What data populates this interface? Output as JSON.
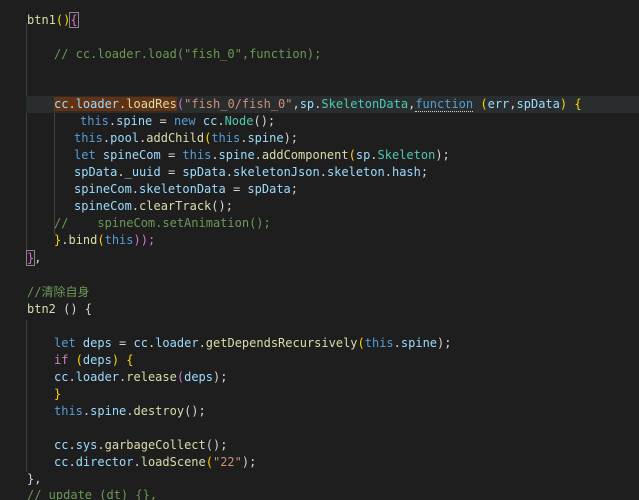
{
  "editor": {
    "lines": {
      "l1": {
        "name": "btn1",
        "paren": "()",
        "brace": "{"
      },
      "l3": {
        "comment": "// cc.loader.load(\"fish_0\",function);"
      },
      "l6": {
        "obj": "cc",
        "dot1": ".",
        "prop": "loader",
        "dot2": ".",
        "fn": "loadRes",
        "open": "(",
        "str": "\"fish_0/fish_0\"",
        "comma1": ",",
        "ns": "sp",
        "dot3": ".",
        "cls": "SkeletonData",
        "comma2": ",",
        "kw": "function",
        "space": " ",
        "argsOpen": "(",
        "arg1": "err",
        "comma3": ",",
        "arg2": "spData",
        "argsClose": ")",
        "brace": " {"
      },
      "l7": {
        "this": "this",
        "a": ".",
        "b": "spine",
        "c": " = ",
        "new": "new",
        "d": " ",
        "e": "cc",
        "f": ".",
        "g": "Node",
        "h": "();"
      },
      "l8": {
        "this": "this",
        "a": ".",
        "b": "pool",
        "c": ".",
        "fn": "addChild",
        "d": "(",
        "this2": "this",
        "e": ".",
        "f": "spine",
        "g": ");"
      },
      "l9": {
        "let": "let",
        "a": " ",
        "b": "spineCom",
        "c": " = ",
        "this": "this",
        "d": ".",
        "e": "spine",
        "f": ".",
        "fn": "addComponent",
        "g": "(",
        "h": "sp",
        "i": ".",
        "cls": "Skeleton",
        "j": ");"
      },
      "l10": {
        "a": "spData",
        "b": ".",
        "c": "_uuid",
        "d": " = ",
        "e": "spData",
        "f": ".",
        "g": "skeletonJson",
        "h": ".",
        "i": "skeleton",
        "j": ".",
        "k": "hash",
        "l": ";"
      },
      "l11": {
        "a": "spineCom",
        "b": ".",
        "c": "skeletonData",
        "d": " = ",
        "e": "spData",
        "f": ";"
      },
      "l12": {
        "a": "spineCom",
        "b": ".",
        "fn": "clearTrack",
        "c": "();"
      },
      "l13": {
        "comment": "//    spineCom.setAnimation();"
      },
      "l14": {
        "a": "}",
        "b": ".",
        "fn": "bind",
        "c": "(",
        "this": "this",
        "d": "));"
      },
      "l15": {
        "a": "}",
        "b": ","
      },
      "l17": {
        "comment": "//清除自身"
      },
      "l18": {
        "name": "btn2",
        "a": " () {"
      },
      "l20": {
        "let": "let",
        "a": " ",
        "b": "deps",
        "c": " = ",
        "d": "cc",
        "e": ".",
        "f": "loader",
        "g": ".",
        "fn": "getDependsRecursively",
        "h": "(",
        "this": "this",
        "i": ".",
        "j": "spine",
        "k": ");"
      },
      "l21": {
        "if": "if",
        "a": " (",
        "b": "deps",
        "c": ") {"
      },
      "l22": {
        "a": "cc",
        "b": ".",
        "c": "loader",
        "d": ".",
        "fn": "release",
        "e": "(",
        "f": "deps",
        "g": ");"
      },
      "l23": {
        "a": "}"
      },
      "l24": {
        "this": "this",
        "a": ".",
        "b": "spine",
        "c": ".",
        "fn": "destroy",
        "d": "();"
      },
      "l26": {
        "a": "cc",
        "b": ".",
        "c": "sys",
        "d": ".",
        "fn": "garbageCollect",
        "e": "();"
      },
      "l27": {
        "a": "cc",
        "b": ".",
        "c": "director",
        "d": ".",
        "fn": "loadScene",
        "e": "(",
        "str": "\"22\"",
        "f": ");"
      },
      "l28": {
        "a": "},"
      },
      "l29": {
        "comment": "// update (dt) {},"
      }
    }
  }
}
